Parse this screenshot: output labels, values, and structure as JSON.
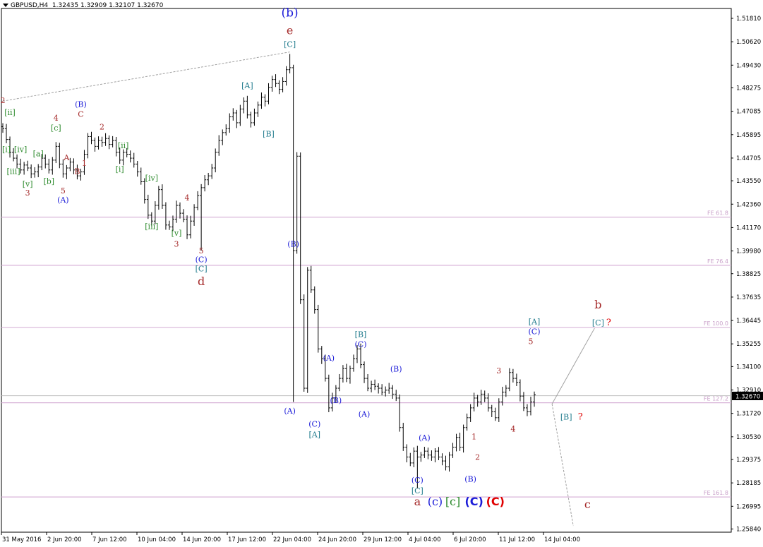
{
  "header": {
    "symbol": "GBPUSD,H4",
    "ohlc": "1.32435 1.32909 1.32107 1.32670"
  },
  "colors": {
    "fib": "#d8b4d8",
    "fib_text": "#c9a0c9",
    "price_line": "#c0c0c0",
    "candle": "#000000",
    "dark_red": "#a52a2a",
    "blue": "#1c1cd8",
    "teal": "#1f7a8c",
    "green": "#2e8b2e",
    "trend": "#a0a0a0"
  },
  "chart_data": {
    "type": "ohlc",
    "price_tag": "1.32670",
    "y_ticks": [
      "1.51810",
      "1.50620",
      "1.49430",
      "1.48275",
      "1.47085",
      "1.45895",
      "1.44705",
      "1.43550",
      "1.42360",
      "1.41170",
      "1.39980",
      "1.38825",
      "1.37635",
      "1.36445",
      "1.35255",
      "1.34100",
      "1.32910",
      "1.31720",
      "1.30530",
      "1.29375",
      "1.28185",
      "1.26995",
      "1.25840"
    ],
    "x_ticks": [
      "31 May 2016",
      "2 Jun 20:00",
      "7 Jun 12:00",
      "10 Jun 04:00",
      "14 Jun 20:00",
      "17 Jun 12:00",
      "22 Jun 04:00",
      "24 Jun 20:00",
      "29 Jun 12:00",
      "4 Jul 04:00",
      "6 Jul 20:00",
      "11 Jul 12:00",
      "14 Jul 04:00"
    ],
    "levels": [
      {
        "name": "FE 61.8",
        "price": 1.417
      },
      {
        "name": "FE 76.4",
        "price": 1.3925
      },
      {
        "name": "FE 100.0",
        "price": 1.3609
      },
      {
        "name": "FE 127.2",
        "price": 1.3226
      },
      {
        "name": "FE 161.8",
        "price": 1.2747
      }
    ],
    "price_lines": [
      1.3262
    ],
    "closes": [
      1.462,
      1.4565,
      1.45,
      1.447,
      1.444,
      1.441,
      1.4435,
      1.442,
      1.439,
      1.44,
      1.4425,
      1.447,
      1.444,
      1.441,
      1.446,
      1.453,
      1.444,
      1.439,
      1.442,
      1.445,
      1.441,
      1.438,
      1.44,
      1.449,
      1.458,
      1.456,
      1.453,
      1.456,
      1.455,
      1.457,
      1.454,
      1.456,
      1.45,
      1.446,
      1.45,
      1.449,
      1.447,
      1.444,
      1.44,
      1.435,
      1.426,
      1.418,
      1.415,
      1.423,
      1.431,
      1.423,
      1.413,
      1.412,
      1.416,
      1.423,
      1.419,
      1.416,
      1.408,
      1.415,
      1.422,
      1.428,
      1.432,
      1.436,
      1.438,
      1.442,
      1.45,
      1.456,
      1.46,
      1.462,
      1.468,
      1.47,
      1.465,
      1.472,
      1.476,
      1.469,
      1.465,
      1.47,
      1.474,
      1.478,
      1.476,
      1.483,
      1.487,
      1.485,
      1.482,
      1.486,
      1.492,
      1.493,
      1.4,
      1.448,
      1.375,
      1.33,
      1.39,
      1.38,
      1.37,
      1.35,
      1.345,
      1.335,
      1.32,
      1.325,
      1.33,
      1.335,
      1.34,
      1.335,
      1.34,
      1.345,
      1.35,
      1.342,
      1.335,
      1.33,
      1.332,
      1.331,
      1.33,
      1.328,
      1.329,
      1.33,
      1.327,
      1.325,
      1.31,
      1.3,
      1.295,
      1.292,
      1.298,
      1.295,
      1.296,
      1.298,
      1.296,
      1.295,
      1.298,
      1.295,
      1.293,
      1.29,
      1.296,
      1.3,
      1.305,
      1.3,
      1.31,
      1.315,
      1.32,
      1.325,
      1.323,
      1.327,
      1.325,
      1.32,
      1.318,
      1.315,
      1.323,
      1.328,
      1.33,
      1.338,
      1.335,
      1.333,
      1.326,
      1.32,
      1.318,
      1.323,
      1.3267
    ],
    "wave_labels": [
      {
        "t": "(b)",
        "i": 81,
        "p": 1.519,
        "c": "blue",
        "s": 17
      },
      {
        "t": "e",
        "i": 81,
        "p": 1.51,
        "c": "dark_red",
        "s": 16
      },
      {
        "t": "[C]",
        "i": 81,
        "p": 1.5035,
        "c": "teal",
        "s": 11
      },
      {
        "t": "[A]",
        "i": 69,
        "p": 1.4825,
        "c": "teal",
        "s": 11
      },
      {
        "t": "[B]",
        "i": 75,
        "p": 1.458,
        "c": "teal",
        "s": 11
      },
      {
        "t": "2",
        "i": 0,
        "p": 1.475,
        "c": "dark_red",
        "s": 11
      },
      {
        "t": "[ii]",
        "i": 2,
        "p": 1.469,
        "c": "green",
        "s": 11
      },
      {
        "t": "[i]",
        "i": 1,
        "p": 1.45,
        "c": "green",
        "s": 11
      },
      {
        "t": "[iv]",
        "i": 5,
        "p": 1.45,
        "c": "green",
        "s": 11
      },
      {
        "t": "[a]",
        "i": 10,
        "p": 1.448,
        "c": "green",
        "s": 11
      },
      {
        "t": "[iii]",
        "i": 3,
        "p": 1.439,
        "c": "green",
        "s": 11
      },
      {
        "t": "[v]",
        "i": 7,
        "p": 1.4325,
        "c": "green",
        "s": 11
      },
      {
        "t": "3",
        "i": 7,
        "p": 1.428,
        "c": "dark_red",
        "s": 11
      },
      {
        "t": "4",
        "i": 15,
        "p": 1.466,
        "c": "dark_red",
        "s": 11
      },
      {
        "t": "[c]",
        "i": 15,
        "p": 1.461,
        "c": "green",
        "s": 11
      },
      {
        "t": "[b]",
        "i": 13,
        "p": 1.434,
        "c": "green",
        "s": 11
      },
      {
        "t": "5",
        "i": 17,
        "p": 1.429,
        "c": "dark_red",
        "s": 11
      },
      {
        "t": "(A)",
        "i": 17,
        "p": 1.4245,
        "c": "blue",
        "s": 11
      },
      {
        "t": "A",
        "i": 18,
        "p": 1.446,
        "c": "dark_red",
        "s": 11
      },
      {
        "t": "B",
        "i": 21,
        "p": 1.439,
        "c": "dark_red",
        "s": 11
      },
      {
        "t": "1",
        "i": 23,
        "p": 1.443,
        "c": "dark_red",
        "s": 11
      },
      {
        "t": "(B)",
        "i": 22,
        "p": 1.473,
        "c": "blue",
        "s": 11
      },
      {
        "t": "C",
        "i": 22,
        "p": 1.468,
        "c": "dark_red",
        "s": 11
      },
      {
        "t": "2",
        "i": 28,
        "p": 1.4615,
        "c": "dark_red",
        "s": 11
      },
      {
        "t": "[ii]",
        "i": 34,
        "p": 1.452,
        "c": "green",
        "s": 11
      },
      {
        "t": "[i]",
        "i": 33,
        "p": 1.44,
        "c": "green",
        "s": 11
      },
      {
        "t": "[iv]",
        "i": 42,
        "p": 1.4355,
        "c": "green",
        "s": 11
      },
      {
        "t": "4",
        "i": 52,
        "p": 1.4255,
        "c": "dark_red",
        "s": 11
      },
      {
        "t": "[iii]",
        "i": 42,
        "p": 1.411,
        "c": "green",
        "s": 11
      },
      {
        "t": "[v]",
        "i": 49,
        "p": 1.4075,
        "c": "green",
        "s": 11
      },
      {
        "t": "3",
        "i": 49,
        "p": 1.402,
        "c": "dark_red",
        "s": 11
      },
      {
        "t": "5",
        "i": 56,
        "p": 1.3985,
        "c": "dark_red",
        "s": 11
      },
      {
        "t": "(C)",
        "i": 56,
        "p": 1.394,
        "c": "blue",
        "s": 11
      },
      {
        "t": "[C]",
        "i": 56,
        "p": 1.3895,
        "c": "teal",
        "s": 11
      },
      {
        "t": "d",
        "i": 56,
        "p": 1.3825,
        "c": "dark_red",
        "s": 16
      },
      {
        "t": "(B)",
        "i": 82,
        "p": 1.402,
        "c": "blue",
        "s": 11
      },
      {
        "t": "(A)",
        "i": 81,
        "p": 1.317,
        "c": "blue",
        "s": 11
      },
      {
        "t": "(C)",
        "i": 88,
        "p": 1.3105,
        "c": "blue",
        "s": 11
      },
      {
        "t": "[A]",
        "i": 88,
        "p": 1.305,
        "c": "teal",
        "s": 11
      },
      {
        "t": "(A)",
        "i": 92,
        "p": 1.344,
        "c": "blue",
        "s": 11
      },
      {
        "t": "(B)",
        "i": 94,
        "p": 1.3225,
        "c": "blue",
        "s": 11
      },
      {
        "t": "[B]",
        "i": 101,
        "p": 1.356,
        "c": "teal",
        "s": 11
      },
      {
        "t": "(C)",
        "i": 101,
        "p": 1.351,
        "c": "blue",
        "s": 11
      },
      {
        "t": "(A)",
        "i": 102,
        "p": 1.3155,
        "c": "blue",
        "s": 11
      },
      {
        "t": "(B)",
        "i": 111,
        "p": 1.3385,
        "c": "blue",
        "s": 11
      },
      {
        "t": "(A)",
        "i": 119,
        "p": 1.3035,
        "c": "blue",
        "s": 11
      },
      {
        "t": "(C)",
        "i": 117,
        "p": 1.282,
        "c": "blue",
        "s": 11
      },
      {
        "t": "[C]",
        "i": 117,
        "p": 1.2765,
        "c": "teal",
        "s": 11
      },
      {
        "t": "a",
        "i": 117,
        "p": 1.2705,
        "c": "dark_red",
        "s": 16
      },
      {
        "t": "(c)",
        "i": 122,
        "p": 1.2705,
        "c": "blue",
        "s": 16
      },
      {
        "t": "[c]",
        "i": 127,
        "p": 1.2705,
        "c": "green",
        "s": 16
      },
      {
        "t": "(C)",
        "i": 133,
        "p": 1.2705,
        "c": "blue",
        "s": 16,
        "b": true
      },
      {
        "t": "(C)",
        "i": 139,
        "p": 1.2705,
        "c": "red",
        "s": 16,
        "b": true
      },
      {
        "t": "1",
        "i": 133,
        "p": 1.304,
        "c": "dark_red",
        "s": 11
      },
      {
        "t": "2",
        "i": 134,
        "p": 1.2935,
        "c": "dark_red",
        "s": 11
      },
      {
        "t": "(B)",
        "i": 132,
        "p": 1.2825,
        "c": "blue",
        "s": 11
      },
      {
        "t": "3",
        "i": 140,
        "p": 1.3375,
        "c": "dark_red",
        "s": 11
      },
      {
        "t": "4",
        "i": 144,
        "p": 1.308,
        "c": "dark_red",
        "s": 11
      },
      {
        "t": "[A]",
        "i": 150,
        "p": 1.3625,
        "c": "teal",
        "s": 11
      },
      {
        "t": "(C)",
        "i": 150,
        "p": 1.3575,
        "c": "blue",
        "s": 11
      },
      {
        "t": "5",
        "i": 149,
        "p": 1.3525,
        "c": "dark_red",
        "s": 11
      },
      {
        "t": "b",
        "i": 168,
        "p": 1.3705,
        "c": "dark_red",
        "s": 16
      },
      {
        "t": "[C]",
        "i": 168,
        "p": 1.362,
        "c": "teal",
        "s": 11
      },
      {
        "t": "?",
        "i": 171,
        "p": 1.362,
        "c": "red",
        "s": 13
      },
      {
        "t": "[B]",
        "i": 159,
        "p": 1.314,
        "c": "teal",
        "s": 11
      },
      {
        "t": "?",
        "i": 163,
        "p": 1.314,
        "c": "red",
        "s": 13
      },
      {
        "t": "c",
        "i": 165,
        "p": 1.269,
        "c": "dark_red",
        "s": 16
      }
    ],
    "trend_lines": [
      {
        "i1": 0,
        "p1": 1.476,
        "i2": 81,
        "p2": 1.501,
        "dash": true
      },
      {
        "i1": 155,
        "p1": 1.322,
        "i2": 167,
        "p2": 1.3605,
        "dash": false
      },
      {
        "i1": 155,
        "p1": 1.322,
        "i2": 161,
        "p2": 1.26,
        "dash": true
      }
    ]
  }
}
